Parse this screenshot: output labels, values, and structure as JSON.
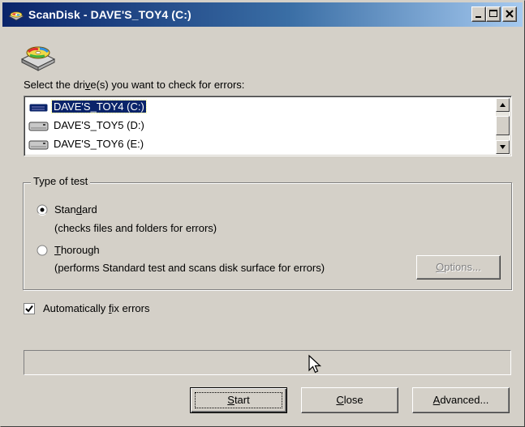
{
  "window": {
    "title": "ScanDisk - DAVE'S_TOY4 (C:)",
    "icon": "scandisk-icon",
    "controls": [
      "minimize-icon",
      "maximize-icon",
      "close-icon"
    ]
  },
  "prompt": {
    "pre": "Select the dri",
    "accel": "v",
    "post": "e(s) you want to check for errors:"
  },
  "drives": [
    {
      "label": "DAVE'S_TOY4 (C:)",
      "selected": true,
      "icon": "hard-drive-icon"
    },
    {
      "label": "DAVE'S_TOY5 (D:)",
      "selected": false,
      "icon": "hard-drive-icon"
    },
    {
      "label": "DAVE'S_TOY6 (E:)",
      "selected": false,
      "icon": "hard-drive-icon"
    }
  ],
  "test_group": {
    "title": "Type of test",
    "standard": {
      "pre": "Stan",
      "accel": "d",
      "post": "ard",
      "description": "(checks files and folders for errors)",
      "checked": true
    },
    "thorough": {
      "pre": "",
      "accel": "T",
      "post": "horough",
      "description": "(performs Standard test and scans disk surface for errors)",
      "checked": false
    },
    "options": {
      "accel": "O",
      "post": "ptions...",
      "enabled": false
    }
  },
  "autofix": {
    "pre": "Automatically ",
    "accel": "f",
    "post": "ix errors",
    "checked": true
  },
  "buttons": {
    "start": {
      "accel": "S",
      "post": "tart"
    },
    "close": {
      "accel": "C",
      "post": "lose"
    },
    "advanced": {
      "accel": "A",
      "post": "dvanced..."
    }
  },
  "colors": {
    "selection": "#0a246a",
    "titlebar_start": "#0a246a",
    "titlebar_end": "#a6caf0",
    "face": "#d4d0c8"
  }
}
